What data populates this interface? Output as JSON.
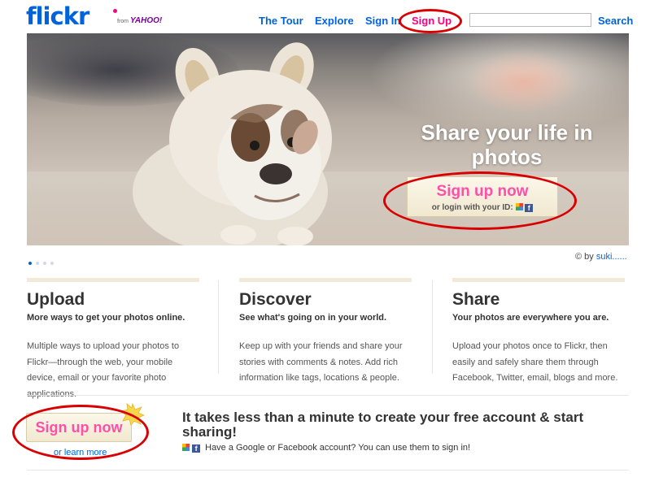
{
  "header": {
    "logo": {
      "flickr": "flickr",
      "from": "from",
      "yahoo": "YAHOO!"
    },
    "nav": {
      "tour": "The Tour",
      "explore": "Explore",
      "sign_in": "Sign In",
      "sign_up": "Sign Up"
    },
    "search": {
      "value": "",
      "button": "Search"
    }
  },
  "hero": {
    "title": "Share your life in photos",
    "button": "Sign up now",
    "login_prefix": "or login with your ID:",
    "credit_prefix": "© by",
    "credit_name": "suki......",
    "slides": 4,
    "active_slide": 1
  },
  "columns": [
    {
      "title": "Upload",
      "subtitle": "More ways to get your photos online.",
      "body": "Multiple ways to upload your photos to Flickr—through the web, your mobile device, email or your favorite photo applications."
    },
    {
      "title": "Discover",
      "subtitle": "See what's going on in your world.",
      "body": "Keep up with your friends and share your stories with comments & notes. Add rich information like tags, locations & people."
    },
    {
      "title": "Share",
      "subtitle": "Your photos are everywhere you are.",
      "body": "Upload your photos once to Flickr, then easily and safely share them through Facebook, Twitter, email, blogs and more."
    }
  ],
  "cta": {
    "button": "Sign up now",
    "learn_more": "or learn more",
    "heading": "It takes less than a minute to create your free account & start sharing!",
    "note": "Have a Google or Facebook account? You can use them to sign in!"
  },
  "colors": {
    "flickr_blue": "#0063dc",
    "flickr_pink": "#ff0084",
    "highlight_ring": "#d80000"
  }
}
